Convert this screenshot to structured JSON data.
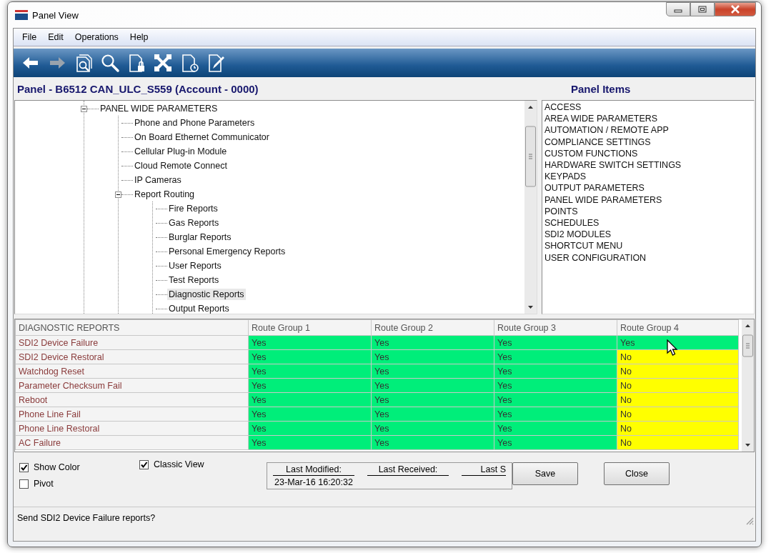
{
  "window": {
    "title": "Panel View"
  },
  "menu": [
    "File",
    "Edit",
    "Operations",
    "Help"
  ],
  "toolbar": [
    {
      "kind": "back",
      "disabled": false
    },
    {
      "kind": "forward",
      "disabled": true
    },
    {
      "kind": "docsearch",
      "disabled": false
    },
    {
      "kind": "search",
      "disabled": false
    },
    {
      "kind": "doclock",
      "disabled": false
    },
    {
      "kind": "plugs",
      "disabled": false
    },
    {
      "kind": "docclock",
      "disabled": false
    },
    {
      "kind": "docpen",
      "disabled": false
    }
  ],
  "panel_title": "Panel - B6512 CAN_ULC_S559 (Account - 0000)",
  "panel_items_title": "Panel Items",
  "tree": [
    {
      "label": "PANEL WIDE PARAMETERS",
      "expanded": true,
      "selected": false,
      "children": [
        {
          "label": "Phone and Phone Parameters",
          "selected": false
        },
        {
          "label": "On Board Ethernet Communicator",
          "selected": false
        },
        {
          "label": "Cellular Plug-in Module",
          "selected": false
        },
        {
          "label": "Cloud Remote Connect",
          "selected": false
        },
        {
          "label": "IP Cameras",
          "selected": false
        },
        {
          "label": "Report Routing",
          "expanded": true,
          "selected": false,
          "children": [
            {
              "label": "Fire Reports",
              "selected": false
            },
            {
              "label": "Gas Reports",
              "selected": false
            },
            {
              "label": "Burglar Reports",
              "selected": false
            },
            {
              "label": "Personal Emergency Reports",
              "selected": false
            },
            {
              "label": "User Reports",
              "selected": false
            },
            {
              "label": "Test Reports",
              "selected": false
            },
            {
              "label": "Diagnostic Reports",
              "selected": true
            },
            {
              "label": "Output Reports",
              "selected": false
            }
          ]
        }
      ]
    }
  ],
  "panel_items": [
    "ACCESS",
    "AREA WIDE PARAMETERS",
    "AUTOMATION / REMOTE APP",
    "COMPLIANCE SETTINGS",
    "CUSTOM FUNCTIONS",
    "HARDWARE SWITCH SETTINGS",
    "KEYPADS",
    "OUTPUT PARAMETERS",
    "PANEL WIDE PARAMETERS",
    "POINTS",
    "SCHEDULES",
    "SDI2 MODULES",
    "SHORTCUT MENU",
    "USER CONFIGURATION"
  ],
  "grid": {
    "columns": [
      "DIAGNOSTIC REPORTS",
      "Route Group 1",
      "Route Group 2",
      "Route Group 3",
      "Route Group 4"
    ],
    "rows": [
      {
        "cells": [
          {
            "text": "SDI2 Device Failure"
          },
          {
            "text": "Yes",
            "color": "#00ee7a"
          },
          {
            "text": "Yes",
            "color": "#00ee7a"
          },
          {
            "text": "Yes",
            "color": "#00ee7a"
          },
          {
            "text": "Yes",
            "color": "#00ee7a"
          }
        ]
      },
      {
        "cells": [
          {
            "text": "SDI2 Device Restoral"
          },
          {
            "text": "Yes",
            "color": "#00ee7a"
          },
          {
            "text": "Yes",
            "color": "#00ee7a"
          },
          {
            "text": "Yes",
            "color": "#00ee7a"
          },
          {
            "text": "No",
            "color": "#ffff00"
          }
        ]
      },
      {
        "cells": [
          {
            "text": "Watchdog Reset"
          },
          {
            "text": "Yes",
            "color": "#00ee7a"
          },
          {
            "text": "Yes",
            "color": "#00ee7a"
          },
          {
            "text": "Yes",
            "color": "#00ee7a"
          },
          {
            "text": "No",
            "color": "#ffff00"
          }
        ]
      },
      {
        "cells": [
          {
            "text": "Parameter Checksum Fail"
          },
          {
            "text": "Yes",
            "color": "#00ee7a"
          },
          {
            "text": "Yes",
            "color": "#00ee7a"
          },
          {
            "text": "Yes",
            "color": "#00ee7a"
          },
          {
            "text": "No",
            "color": "#ffff00"
          }
        ]
      },
      {
        "cells": [
          {
            "text": "Reboot"
          },
          {
            "text": "Yes",
            "color": "#00ee7a"
          },
          {
            "text": "Yes",
            "color": "#00ee7a"
          },
          {
            "text": "Yes",
            "color": "#00ee7a"
          },
          {
            "text": "No",
            "color": "#ffff00"
          }
        ]
      },
      {
        "cells": [
          {
            "text": "Phone Line Fail"
          },
          {
            "text": "Yes",
            "color": "#00ee7a"
          },
          {
            "text": "Yes",
            "color": "#00ee7a"
          },
          {
            "text": "Yes",
            "color": "#00ee7a"
          },
          {
            "text": "No",
            "color": "#ffff00"
          }
        ]
      },
      {
        "cells": [
          {
            "text": "Phone Line Restoral"
          },
          {
            "text": "Yes",
            "color": "#00ee7a"
          },
          {
            "text": "Yes",
            "color": "#00ee7a"
          },
          {
            "text": "Yes",
            "color": "#00ee7a"
          },
          {
            "text": "No",
            "color": "#ffff00"
          }
        ]
      },
      {
        "cells": [
          {
            "text": "AC Failure"
          },
          {
            "text": "Yes",
            "color": "#00ee7a"
          },
          {
            "text": "Yes",
            "color": "#00ee7a"
          },
          {
            "text": "Yes",
            "color": "#00ee7a"
          },
          {
            "text": "No",
            "color": "#ffff00"
          }
        ]
      }
    ]
  },
  "options": [
    {
      "label": "Show Color",
      "checked": true
    },
    {
      "label": "Pivot",
      "checked": false
    },
    {
      "label": "Classic View",
      "checked": true
    }
  ],
  "status_fields": [
    {
      "label": "Last Modified:",
      "value": "23-Mar-16 16:20:32"
    },
    {
      "label": "Last Received:"
    },
    {
      "label": "Last S"
    }
  ],
  "buttons": [
    "Save",
    "Close"
  ],
  "status_bar": "Send SDI2 Device Failure reports?"
}
